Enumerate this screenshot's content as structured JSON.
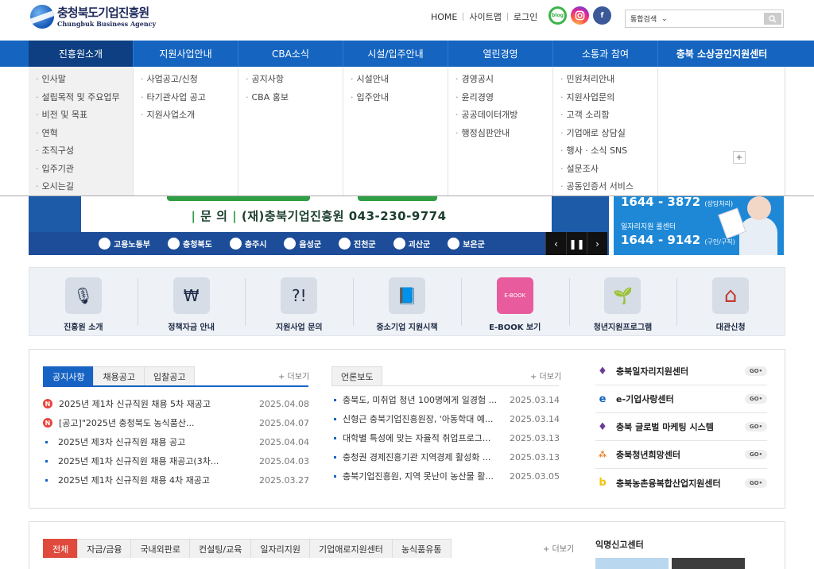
{
  "header": {
    "logo_ko": "충청북도기업진흥원",
    "logo_en": "Chungbuk Business Agency",
    "util": [
      "HOME",
      "사이트맵",
      "로그인"
    ],
    "sns": {
      "blog": "blog",
      "instagram": "instagram-icon",
      "facebook": "f"
    },
    "search": {
      "scope": "통합검색",
      "placeholder": "",
      "button_icon": "search-icon"
    }
  },
  "gnb": [
    {
      "label": "진흥원소개"
    },
    {
      "label": "지원사업안내"
    },
    {
      "label": "CBA소식"
    },
    {
      "label": "시설/입주안내"
    },
    {
      "label": "열린경영"
    },
    {
      "label": "소통과 참여"
    },
    {
      "label": "충북 소상공인지원센터"
    }
  ],
  "mega": [
    [
      "인사말",
      "설립목적 및 주요업무",
      "비전 및 목표",
      "연혁",
      "조직구성",
      "입주기관",
      "오시는길"
    ],
    [
      "사업공고/신청",
      "타기관사업 공고",
      "지원사업소개"
    ],
    [
      "공지사항",
      "CBA 홍보"
    ],
    [
      "시설안내",
      "입주안내"
    ],
    [
      "경영공시",
      "윤리경영",
      "공공데이터개방",
      "행정심판안내"
    ],
    [
      "민원처리안내",
      "지원사업문의",
      "고객 소리함",
      "기업애로 상담실",
      "행사 · 소식 SNS",
      "설문조사",
      "공동인증서 서비스"
    ]
  ],
  "banner": {
    "phone_label": "문  의",
    "phone_text": "(재)충북기업진흥원 043-230-9774",
    "logos": [
      "고용노동부",
      "충청북도",
      "충주시",
      "음성군",
      "진천군",
      "괴산군",
      "보은군"
    ],
    "controls": [
      "‹",
      "❚❚",
      "›"
    ],
    "right": {
      "line1": "1644 - 3872",
      "line1_small": "(상담처리)",
      "line2": "일자리지원 콜센터",
      "line3": "1644 - 9142",
      "line3_small": "(구인/구직)"
    }
  },
  "quick": [
    {
      "label": "진흥원 소개",
      "icon": "microphone-icon",
      "glyph": "🎙"
    },
    {
      "label": "정책자금 안내",
      "icon": "money-hand-icon",
      "glyph": "₩"
    },
    {
      "label": "지원사업 문의",
      "icon": "question-icon",
      "glyph": "?!"
    },
    {
      "label": "중소기업 지원시책",
      "icon": "book-icon",
      "glyph": "📘"
    },
    {
      "label": "E-BOOK 보기",
      "icon": "ebook-icon",
      "glyph": "E-BOOK"
    },
    {
      "label": "청년지원프로그램",
      "icon": "sprout-icon",
      "glyph": "🌱"
    },
    {
      "label": "대관신청",
      "icon": "house-icon",
      "glyph": "⌂"
    }
  ],
  "notice": {
    "tabs": [
      "공지사항",
      "채용공고",
      "입찰공고"
    ],
    "more": "+ 더보기",
    "items": [
      {
        "badge": "N",
        "title": "2025년 제1차 신규직원 채용 5차 재공고",
        "date": "2025.04.08"
      },
      {
        "badge": "N",
        "title": "[공고]\"2025년 충청북도 농식품산...",
        "date": "2025.04.07"
      },
      {
        "badge": "",
        "title": "2025년 제3차 신규직원 채용 공고",
        "date": "2025.04.04"
      },
      {
        "badge": "",
        "title": "2025년 제1차 신규직원 채용 재공고(3차...",
        "date": "2025.04.03"
      },
      {
        "badge": "",
        "title": "2025년 제1차 신규직원 채용 4차 재공고",
        "date": "2025.03.27"
      }
    ]
  },
  "press": {
    "tab": "언론보도",
    "more": "+ 더보기",
    "items": [
      {
        "title": "충북도, 미취업 청년 100명에게 일경험 ...",
        "date": "2025.03.14"
      },
      {
        "title": "신형근 충북기업진흥원장, '아동학대 예...",
        "date": "2025.03.14"
      },
      {
        "title": "대학별 특성에 맞는 자율적 취업프로그...",
        "date": "2025.03.13"
      },
      {
        "title": "충청권 경제진흥기관 지역경제 활성화 ...",
        "date": "2025.03.13"
      },
      {
        "title": "충북기업진흥원, 지역 못난이 농산물 활...",
        "date": "2025.03.05"
      }
    ]
  },
  "sites": [
    {
      "name": "충북일자리지원센터",
      "icon": "chungbuk-icon",
      "go": "GO•"
    },
    {
      "name": "e-기업사랑센터",
      "icon": "e-icon",
      "go": "GO•"
    },
    {
      "name": "충북 글로벌 마케팅 시스템",
      "icon": "chungbuk-icon",
      "go": "GO•"
    },
    {
      "name": "충북청년희망센터",
      "icon": "people-icon",
      "go": "GO•"
    },
    {
      "name": "충북농촌융복합산업지원센터",
      "icon": "b-icon",
      "go": "GO•"
    }
  ],
  "support": {
    "tabs": [
      "전체",
      "자금/금융",
      "국내외판로",
      "컨설팅/교육",
      "일자리지원",
      "기업애로지원센터",
      "농식품유통"
    ],
    "more": "+ 더보기"
  },
  "report": {
    "title": "익명신고센터"
  },
  "colors": {
    "primary": "#1565c0",
    "active": "#0d3f82",
    "badge": "#e8453c",
    "red_tab": "#e04a3c"
  }
}
